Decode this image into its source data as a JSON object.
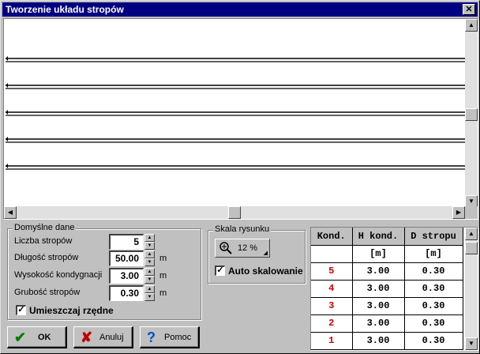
{
  "window": {
    "title": "Tworzenie układu stropów",
    "close_glyph": "✕"
  },
  "defaults": {
    "legend": "Domyślne dane",
    "fields": [
      {
        "label": "Liczba stropów",
        "value": "5",
        "unit": ""
      },
      {
        "label": "Długość stropów",
        "value": "50.00",
        "unit": "m"
      },
      {
        "label": "Wysokość kondygnacji",
        "value": "3.00",
        "unit": "m"
      },
      {
        "label": "Grubość stropów",
        "value": "0.30",
        "unit": "m"
      }
    ],
    "place_ordinates": {
      "label": "Umieszczaj rzędne",
      "checked": true
    }
  },
  "scale": {
    "legend": "Skala rysunku",
    "zoom_value": "12 %",
    "zoom_icon": "magnifier-plus-icon",
    "auto_scale": {
      "label": "Auto skalowanie",
      "checked": true
    }
  },
  "buttons": {
    "ok": "OK",
    "cancel": "Anuluj",
    "help": "Pomoc"
  },
  "table": {
    "headers": [
      "Kond.",
      "H kond.",
      "D stropu"
    ],
    "units": [
      "",
      "[m]",
      "[m]"
    ],
    "rows": [
      {
        "kond": "5",
        "h": "3.00",
        "d": "0.30"
      },
      {
        "kond": "4",
        "h": "3.00",
        "d": "0.30"
      },
      {
        "kond": "3",
        "h": "3.00",
        "d": "0.30"
      },
      {
        "kond": "2",
        "h": "3.00",
        "d": "0.30"
      },
      {
        "kond": "1",
        "h": "3.00",
        "d": "0.30"
      }
    ]
  },
  "drawing": {
    "floor_count": 5
  },
  "colors": {
    "title_bar": "#000080",
    "floor_number": "#d00000",
    "check_icon": "#008000",
    "cancel_icon": "#c00000",
    "help_icon": "#0050c8"
  }
}
